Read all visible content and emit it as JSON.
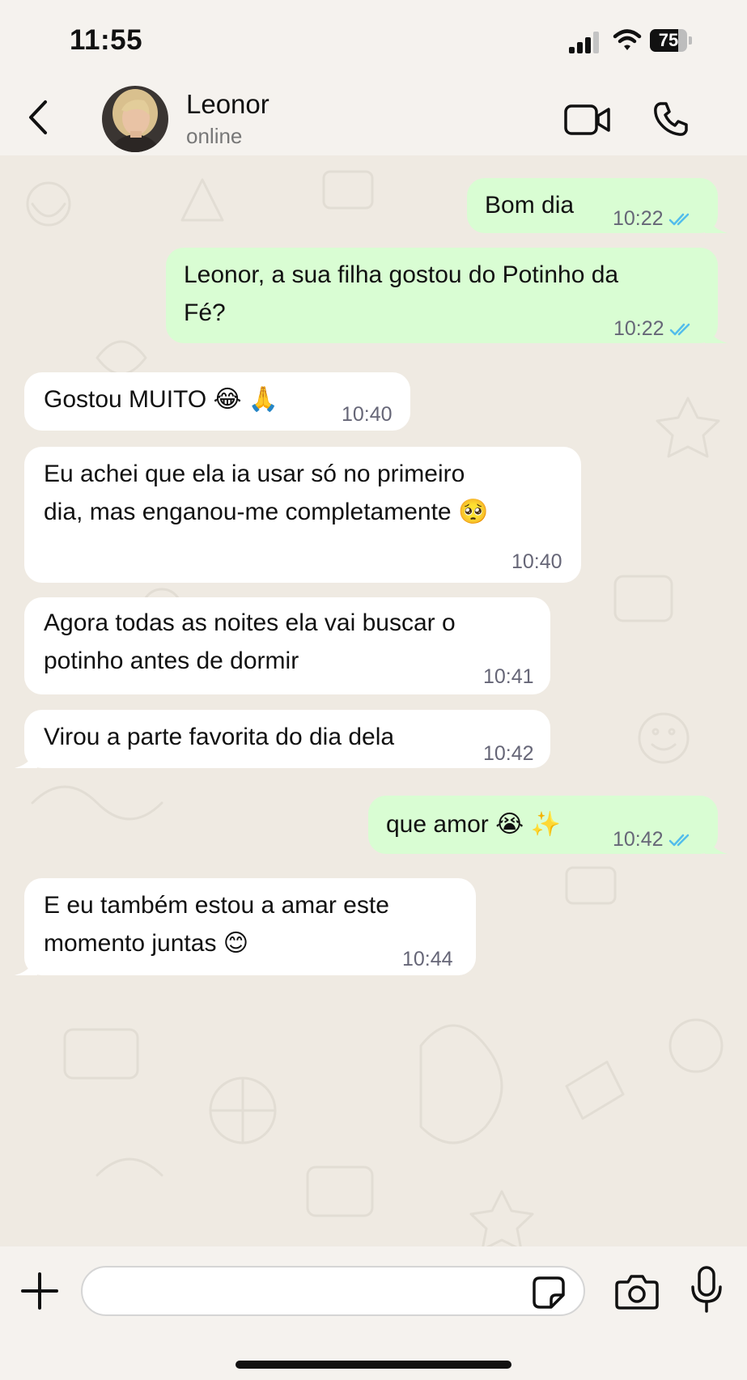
{
  "status_bar": {
    "time": "11:55",
    "battery": "75",
    "battery_level": 0.75
  },
  "header": {
    "contact_name": "Leonor",
    "status": "online"
  },
  "messages": [
    {
      "dir": "out",
      "lines": [
        "Bom dia"
      ],
      "time": "10:22",
      "read": true
    },
    {
      "dir": "out",
      "lines": [
        "Leonor, a sua filha gostou do Potinho da",
        "Fé?"
      ],
      "time": "10:22",
      "read": true
    },
    {
      "dir": "in",
      "lines": [
        "Gostou MUITO 😂 🙏"
      ],
      "time": "10:40"
    },
    {
      "dir": "in",
      "lines": [
        "Eu achei que ela ia usar só no primeiro",
        "dia, mas enganou-me completamente 🥺"
      ],
      "time": "10:40"
    },
    {
      "dir": "in",
      "lines": [
        "Agora todas as noites ela vai buscar o",
        "potinho antes de dormir"
      ],
      "time": "10:41"
    },
    {
      "dir": "in",
      "lines": [
        "Virou a parte favorita do dia dela"
      ],
      "time": "10:42"
    },
    {
      "dir": "out",
      "lines": [
        "que amor 😭 ✨"
      ],
      "time": "10:42",
      "read": true
    },
    {
      "dir": "in",
      "lines": [
        "E eu também estou a amar este",
        "momento juntas 😊"
      ],
      "time": "10:44"
    }
  ],
  "colors": {
    "outgoing_bubble": "#d9fdd3",
    "incoming_bubble": "#ffffff",
    "read_ticks": "#53bdeb",
    "wallpaper": "#efeae2"
  },
  "icons": [
    "back-chevron-icon",
    "video-call-icon",
    "phone-icon",
    "plus-icon",
    "sticker-icon",
    "camera-icon",
    "microphone-icon"
  ]
}
